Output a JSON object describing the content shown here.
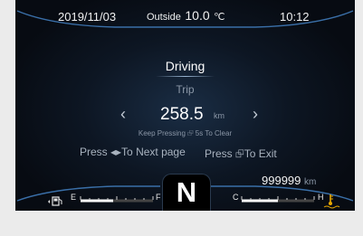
{
  "status": {
    "date": "2019/11/03",
    "outside_label": "Outside",
    "outside_temp": "10.0",
    "temp_unit": "℃",
    "time": "10:12"
  },
  "screen": {
    "title": "Driving",
    "subtitle": "Trip",
    "value": "258.5",
    "value_unit": "km",
    "hint": "Keep Pressing ⮺ 5s To Clear",
    "prev_arrow": "‹",
    "next_arrow": "›",
    "next_page": "Press ◂▸To Next page",
    "exit": "Press ⮺To Exit"
  },
  "odometer": {
    "value": "999999",
    "unit": "km"
  },
  "fuel_gauge": {
    "empty_label": "E",
    "full_label": "F",
    "level": 0.45,
    "icon": "fuel-pump-icon"
  },
  "temp_gauge": {
    "cold_label": "C",
    "hot_label": "H",
    "level": 0.5,
    "icon": "coolant-temp-icon"
  },
  "gear": "N",
  "colors": {
    "accent": "#3a8fd9",
    "gauge_fill": "#ffffff"
  }
}
